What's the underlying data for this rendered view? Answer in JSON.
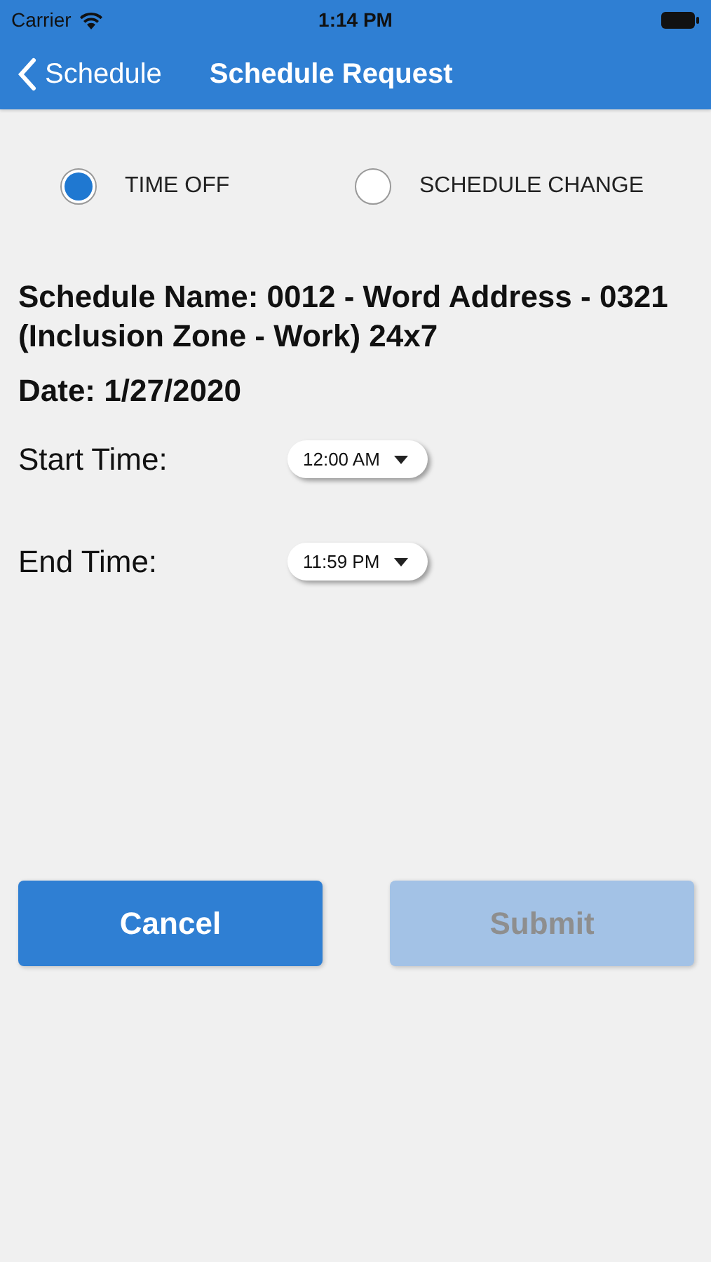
{
  "status_bar": {
    "carrier": "Carrier",
    "time": "1:14 PM"
  },
  "nav": {
    "back_label": "Schedule",
    "title": "Schedule Request"
  },
  "request_types": [
    {
      "label": "TIME OFF",
      "selected": true
    },
    {
      "label": "SCHEDULE CHANGE",
      "selected": false
    }
  ],
  "schedule_name": "Schedule Name: 0012 - Word Address - 0321 (Inclusion Zone - Work) 24x7",
  "date": "Date: 1/27/2020",
  "times": [
    {
      "label": "Start Time:",
      "value": "12:00 AM"
    },
    {
      "label": "End Time:",
      "value": "11:59 PM"
    }
  ],
  "buttons": [
    {
      "label": "Cancel",
      "disabled": false
    },
    {
      "label": "Submit",
      "disabled": true
    }
  ]
}
